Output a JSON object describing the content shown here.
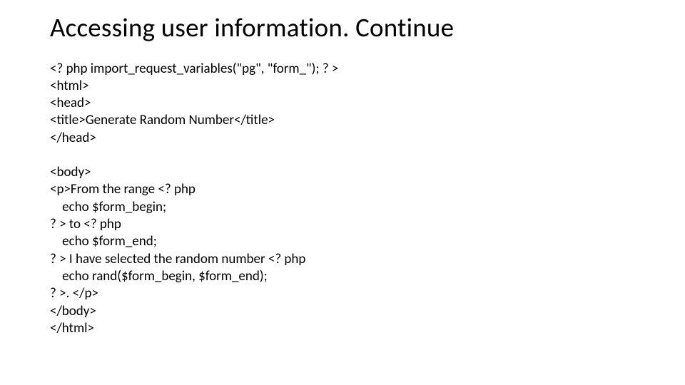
{
  "title": "Accessing user information. Continue",
  "code": {
    "block1": "<? php import_request_variables(\"pg\", \"form_\"); ? >\n<html>\n<head>\n<title>Generate Random Number</title>\n</head>",
    "block2": "<body>\n<p>From the range <? php\n    echo $form_begin;\n? > to <? php\n    echo $form_end;\n? > I have selected the random number <? php\n    echo rand($form_begin, $form_end);\n? >. </p>\n</body>\n</html>"
  }
}
